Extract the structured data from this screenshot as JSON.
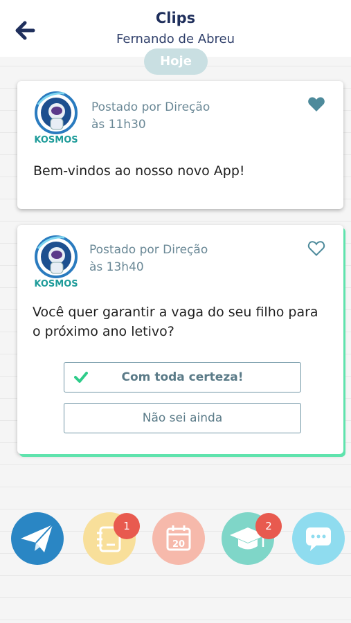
{
  "header": {
    "title": "Clips",
    "subtitle": "Fernando de Abreu",
    "back_icon": "arrow-left-icon"
  },
  "date_separator": "Hoje",
  "logo_text": "KOSMOS",
  "posts": [
    {
      "posted_by": "Postado por Direção",
      "time": "às 11h30",
      "text": "Bem-vindos ao nosso novo App!",
      "liked": true
    },
    {
      "posted_by": "Postado por Direção",
      "time": "às 13h40",
      "text": "Você quer garantir a vaga do seu filho para o próximo ano letivo?",
      "liked": false,
      "options": [
        {
          "label": "Com toda certeza!",
          "selected": true
        },
        {
          "label": "Não sei ainda",
          "selected": false
        }
      ]
    }
  ],
  "dock": [
    {
      "name": "send",
      "icon": "paper-plane-icon",
      "color": "#2a86c4",
      "badge": ""
    },
    {
      "name": "notebook",
      "icon": "notebook-icon",
      "color": "#f8df9a",
      "badge": "1"
    },
    {
      "name": "calendar",
      "icon": "calendar-icon",
      "color": "#f6b9ab",
      "badge": "",
      "date_text": "20"
    },
    {
      "name": "school",
      "icon": "graduation-cap-icon",
      "color": "#7fd6c8",
      "badge": "2"
    },
    {
      "name": "chat",
      "icon": "chat-bubble-icon",
      "color": "#8fdcef",
      "badge": ""
    }
  ],
  "colors": {
    "header_title": "#1f2f5c",
    "accent_green": "#5fe3ad",
    "heart": "#4d8a9b",
    "badge": "#e85a4f"
  }
}
